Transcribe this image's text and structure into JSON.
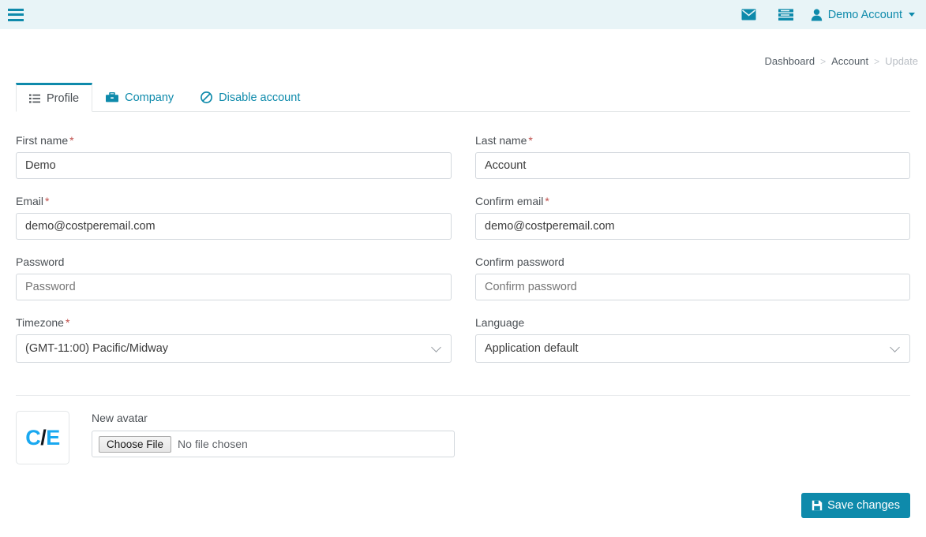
{
  "theme": {
    "accent": "#0e8aab",
    "header_bg": "#e8f4f7",
    "required_star": "#c0504d",
    "avatar_blue": "#19a8f0"
  },
  "topbar": {
    "menu_toggle_name": "menu-toggle",
    "messages_icon": "envelope-icon",
    "tasks_icon": "tasks-icon",
    "user_icon": "user-icon",
    "user_name": "Demo Account",
    "caret": "chevron-down-icon"
  },
  "breadcrumb": [
    {
      "label": "Dashboard",
      "active": false
    },
    {
      "label": "Account",
      "active": false
    },
    {
      "label": "Update",
      "active": true
    }
  ],
  "breadcrumb_separator": ">",
  "tabs": [
    {
      "label": "Profile",
      "icon": "list-icon",
      "active": true
    },
    {
      "label": "Company",
      "icon": "briefcase-icon",
      "active": false
    },
    {
      "label": "Disable account",
      "icon": "ban-icon",
      "active": false
    }
  ],
  "form": {
    "required_marker": "*",
    "first_name": {
      "label": "First name",
      "value": "Demo",
      "required": true
    },
    "last_name": {
      "label": "Last name",
      "value": "Account",
      "required": true
    },
    "email": {
      "label": "Email",
      "value": "demo@costperemail.com",
      "required": true
    },
    "confirm_email": {
      "label": "Confirm email",
      "value": "demo@costperemail.com",
      "required": true
    },
    "password": {
      "label": "Password",
      "value": "",
      "placeholder": "Password",
      "required": false
    },
    "confirm_password": {
      "label": "Confirm password",
      "value": "",
      "placeholder": "Confirm password",
      "required": false
    },
    "timezone": {
      "label": "Timezone",
      "value": "(GMT-11:00) Pacific/Midway",
      "required": true
    },
    "language": {
      "label": "Language",
      "value": "Application default",
      "required": false
    }
  },
  "avatar": {
    "initials_first": "C",
    "initials_slash": "/",
    "initials_last": "E",
    "new_avatar_label": "New avatar",
    "choose_file_button": "Choose File",
    "file_status": "No file chosen"
  },
  "footer": {
    "save_label": "Save changes",
    "save_icon": "save-icon"
  }
}
